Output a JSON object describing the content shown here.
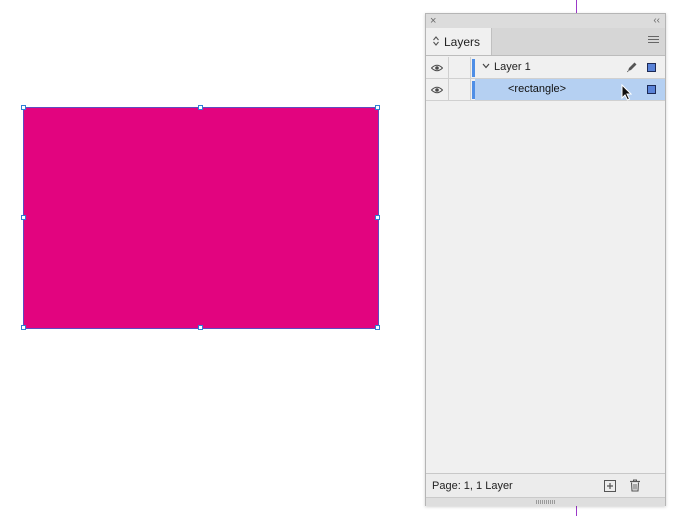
{
  "canvas": {
    "rectangle_fill": "#e2047f",
    "selection_color": "#2f7fd6",
    "guide_color": "#9b39c8"
  },
  "panel": {
    "close_glyph": "×",
    "collapse_glyph": "‹‹",
    "tab": {
      "label": "Layers",
      "updown_glyph": "⇕"
    },
    "menu_icon": "panel-menu-icon",
    "layers": [
      {
        "name": "Layer 1",
        "visible": true,
        "expanded": true,
        "color": "#4e8ee6",
        "icons": [
          "eye-icon",
          "chevron-down-icon",
          "pen-icon",
          "selection-square-icon"
        ]
      },
      {
        "name": "<rectangle>",
        "visible": true,
        "selected": true,
        "highlight": "#b5d0f2",
        "icons": [
          "eye-icon",
          "selection-square-icon"
        ]
      }
    ],
    "footer": {
      "status": "Page: 1, 1 Layer",
      "new_layer_icon": "new-layer-icon",
      "delete_icon": "trash-icon"
    }
  }
}
